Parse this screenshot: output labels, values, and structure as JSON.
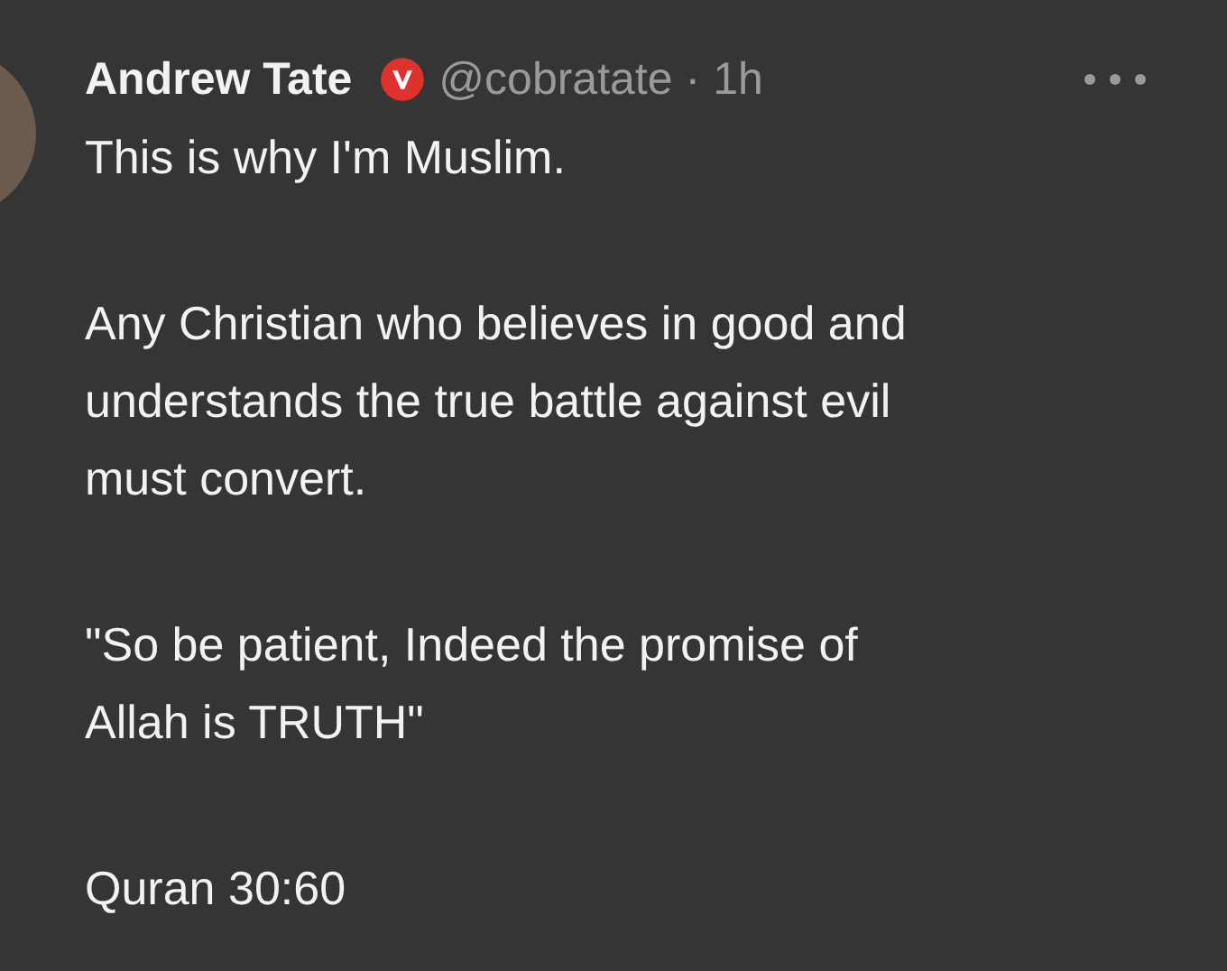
{
  "post": {
    "author": "Andrew Tate",
    "handle": "@cobratate",
    "separator": "·",
    "time": "1h",
    "paragraphs": [
      [
        "This is why I'm Muslim."
      ],
      [
        "Any Christian who believes in good and",
        "understands the true battle against evil",
        "must convert."
      ],
      [
        "\"So be patient, Indeed the promise of",
        "Allah is TRUTH\""
      ],
      [
        "Quran 30:60"
      ]
    ]
  }
}
